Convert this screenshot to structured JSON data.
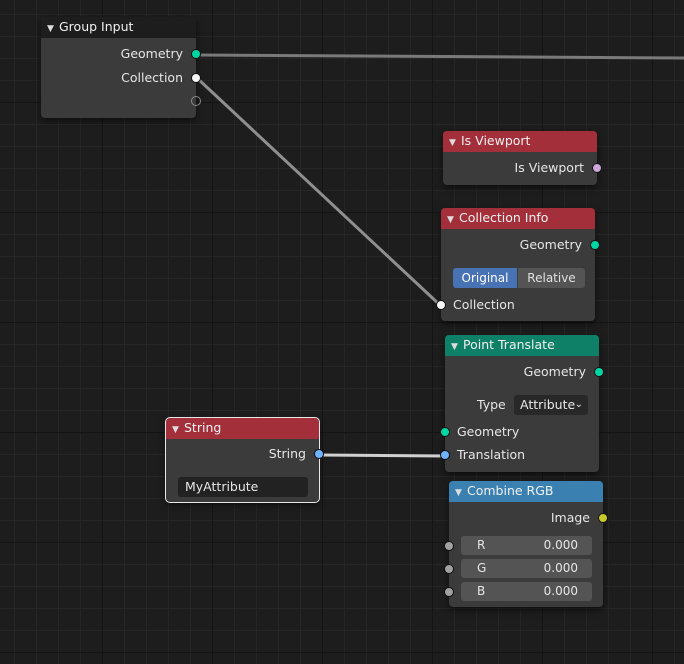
{
  "colors": {
    "group_header": "#1d1d1d",
    "input_header": "#a32f3b",
    "geometry_header": "#0f8068",
    "converter_header": "#3a80b0",
    "socket_geometry": "#00d6a3",
    "socket_collection": "#f5f5f5",
    "socket_vector": "#6363c7",
    "socket_string": "#70b2ff",
    "socket_boolean": "#cca6d6",
    "socket_color": "#c7c729",
    "socket_float": "#a1a1a1"
  },
  "nodes": {
    "group_input": {
      "title": "Group Input",
      "outputs": [
        "Geometry",
        "Collection"
      ]
    },
    "is_viewport": {
      "title": "Is Viewport",
      "outputs": [
        "Is Viewport"
      ]
    },
    "collection_info": {
      "title": "Collection Info",
      "output": "Geometry",
      "transform_space": {
        "options": [
          "Original",
          "Relative"
        ],
        "selected": "Original"
      },
      "input": "Collection"
    },
    "point_translate": {
      "title": "Point Translate",
      "output": "Geometry",
      "type_label": "Type",
      "type_value": "Attribute",
      "inputs": [
        "Geometry",
        "Translation"
      ]
    },
    "string": {
      "title": "String",
      "output": "String",
      "value": "MyAttribute"
    },
    "combine_rgb": {
      "title": "Combine RGB",
      "output": "Image",
      "fields": [
        {
          "label": "R",
          "value": "0.000"
        },
        {
          "label": "G",
          "value": "0.000"
        },
        {
          "label": "B",
          "value": "0.000"
        }
      ]
    }
  }
}
